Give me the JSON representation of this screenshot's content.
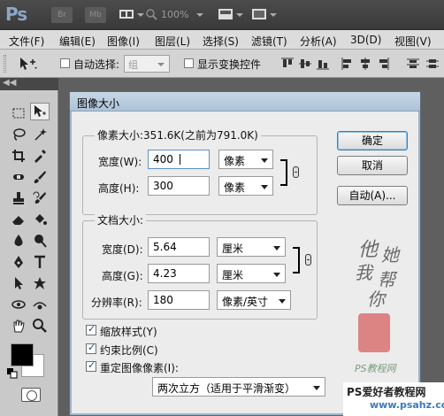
{
  "app": {
    "logo": "Ps",
    "bridge_btn": "Br",
    "minibridge_btn": "Mb",
    "zoom": "100%"
  },
  "menu": [
    "文件(F)",
    "编辑(E)",
    "图像(I)",
    "图层(L)",
    "选择(S)",
    "滤镜(T)",
    "分析(A)",
    "3D(D)",
    "视图(V)"
  ],
  "options": {
    "auto_select_label": "自动选择:",
    "auto_select_value": "组",
    "show_transform_label": "显示变换控件"
  },
  "toolbox": {
    "collapse": "◀◀"
  },
  "dialog": {
    "title": "图像大小",
    "pixel_dims": {
      "legend": "像素大小:351.6K(之前为791.0K)",
      "width_label": "宽度(W):",
      "width_value": "400",
      "width_unit": "像素",
      "height_label": "高度(H):",
      "height_value": "300",
      "height_unit": "像素"
    },
    "doc_size": {
      "legend": "文档大小:",
      "width_label": "宽度(D):",
      "width_value": "5.64",
      "width_unit": "厘米",
      "height_label": "高度(G):",
      "height_value": "4.23",
      "height_unit": "厘米",
      "res_label": "分辨率(R):",
      "res_value": "180",
      "res_unit": "像素/英寸"
    },
    "buttons": {
      "ok": "确定",
      "cancel": "取消",
      "auto": "自动(A)..."
    },
    "checkboxes": {
      "scale_styles": "缩放样式(Y)",
      "constrain": "约束比例(C)",
      "resample": "重定图像像素(I):"
    },
    "resample_method": "两次立方（适用于平滑渐变）"
  },
  "handwriting": {
    "line1": "他",
    "line2": "她",
    "line3": "我",
    "line4": "帮",
    "line5": "你",
    "seal_text": "PS教程网"
  },
  "watermark": {
    "title": "PS爱好者教程网",
    "url": "www.psahz.com"
  }
}
